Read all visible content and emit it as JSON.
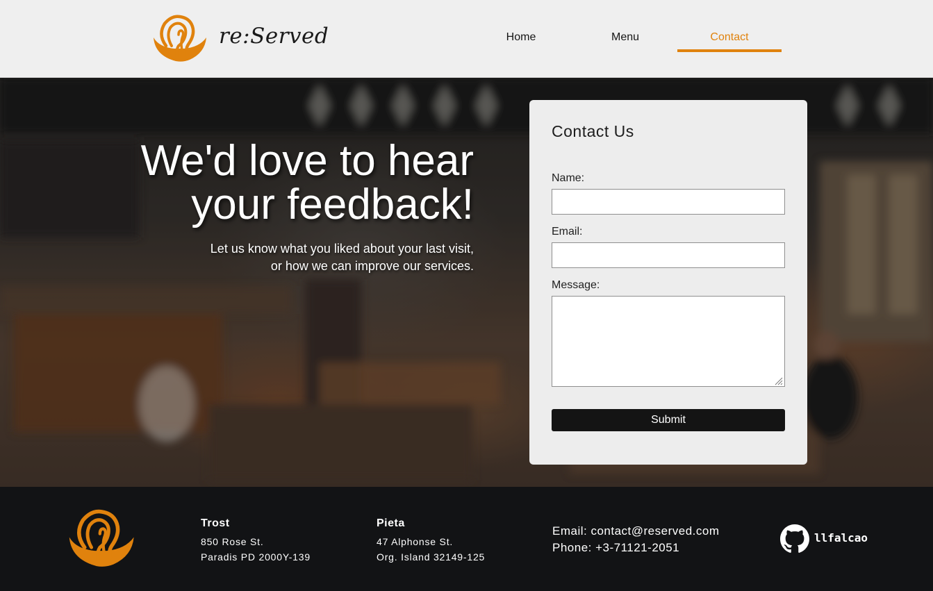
{
  "header": {
    "brand": "re:Served",
    "nav": [
      {
        "label": "Home",
        "active": false
      },
      {
        "label": "Menu",
        "active": false
      },
      {
        "label": "Contact",
        "active": true
      }
    ]
  },
  "hero": {
    "headline_line1": "We'd love to hear",
    "headline_line2": "your feedback!",
    "sub_line1": "Let us know what you liked about your last visit,",
    "sub_line2": "or how we can improve our services."
  },
  "form": {
    "title": "Contact Us",
    "name_label": "Name:",
    "name_value": "",
    "email_label": "Email:",
    "email_value": "",
    "message_label": "Message:",
    "message_value": "",
    "submit_label": "Submit"
  },
  "footer": {
    "locations": [
      {
        "name": "Trost",
        "street": "850 Rose St.",
        "city": "Paradis PD 2000Y-139"
      },
      {
        "name": "Pieta",
        "street": "47 Alphonse St.",
        "city": "Org. Island 32149-125"
      }
    ],
    "email_line": "Email: contact@reserved.com",
    "phone_line": "Phone: +3-71121-2051",
    "github_user": "llfalcao"
  },
  "colors": {
    "accent": "#e0820d",
    "header_bg": "#efefef",
    "footer_bg": "#121315",
    "card_bg": "#ededed",
    "button_bg": "#141414"
  },
  "icons": [
    "logo-icon",
    "github-icon",
    "resize-grip-icon"
  ]
}
